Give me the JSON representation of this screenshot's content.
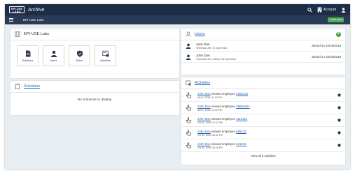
{
  "header": {
    "logo_top": "EPI-USE",
    "logo_bottom": "LABS",
    "title": "Archive",
    "account_label": "Account"
  },
  "subbar": {
    "company": "EPI-USE Labs",
    "invite_label": "Invite user"
  },
  "org": {
    "title": "EPI-USE Labs",
    "tiles": [
      {
        "label": "Solutions",
        "icon": "document-icon"
      },
      {
        "label": "Users",
        "icon": "user-icon"
      },
      {
        "label": "Roles",
        "icon": "shield-icon"
      },
      {
        "label": "Activities",
        "icon": "activity-icon"
      }
    ]
  },
  "solutions": {
    "title": "Solutions",
    "empty_text": "No Solutions to display."
  },
  "users": {
    "title": "Users",
    "items": [
      {
        "name": "Jane Doe",
        "roles": "Technical User, UI Supervisor",
        "joined": "Joined on 10/18/2019"
      },
      {
        "name": "John Doe",
        "roles": "Technical User, Admin, DB Supervisor",
        "joined": "Joined on 10/18/2019"
      }
    ]
  },
  "activities": {
    "title": "Activities",
    "items": [
      {
        "user": "John Doe",
        "action": " viewed employee ",
        "employee": "2084431",
        "date": "Nov 1, 2019, 01:23 PM"
      },
      {
        "user": "John Doe",
        "action": " viewed employee ",
        "employee": "39566451",
        "date": "Nov 1, 2019, 01:23 PM"
      },
      {
        "user": "John Doe",
        "action": " viewed employee ",
        "employee": "1111451",
        "date": "Oct 30, 2019, 07:47 PM"
      },
      {
        "user": "John Doe",
        "action": " viewed employee ",
        "employee": "598130",
        "date": "Oct 30, 2019, 06:41 PM"
      },
      {
        "user": "John Doe",
        "action": " viewed employee ",
        "employee": "321201",
        "date": "Oct 30, 2019, 04:28 PM"
      }
    ],
    "view_all": "View all 5 Activities"
  },
  "colors": {
    "topbar": "#1e2d47",
    "subbar": "#2a3b57",
    "link": "#2a66b5",
    "add": "#43a047"
  }
}
